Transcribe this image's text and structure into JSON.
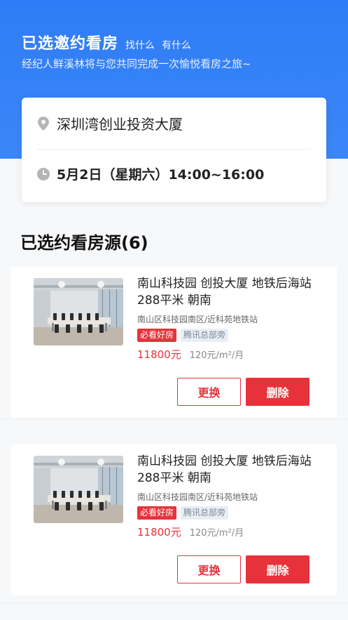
{
  "header": {
    "title": "已选邀约看房",
    "link_find": "找什么",
    "link_have": "有什么",
    "subtitle": "经纪人鲜溪林将与您共同完成一次愉悦看房之旅~"
  },
  "appointment": {
    "address": "深圳湾创业投资大厦",
    "time": "5月2日（星期六）14:00~16:00",
    "icons": [
      "location-pin-icon",
      "clock-icon"
    ]
  },
  "section": {
    "title": "已选约看房源(6)"
  },
  "listings": [
    {
      "title": "南山科技园 创投大厦 地铁后海站288平米 朝南",
      "address": "南山区科技园南区/近科苑地铁站",
      "tag_hot": "必看好房",
      "tag_near": "腾讯总部旁",
      "price": "11800元",
      "unit_price": "120元/m²/月",
      "replace_label": "更换",
      "delete_label": "删除"
    },
    {
      "title": "南山科技园 创投大厦 地铁后海站288平米 朝南",
      "address": "南山区科技园南区/近科苑地铁站",
      "tag_hot": "必看好房",
      "tag_near": "腾讯总部旁",
      "price": "11800元",
      "unit_price": "120元/m²/月",
      "replace_label": "更换",
      "delete_label": "删除"
    }
  ],
  "colors": {
    "header_blue": "#2f7cf6",
    "accent_red": "#e8323b"
  }
}
